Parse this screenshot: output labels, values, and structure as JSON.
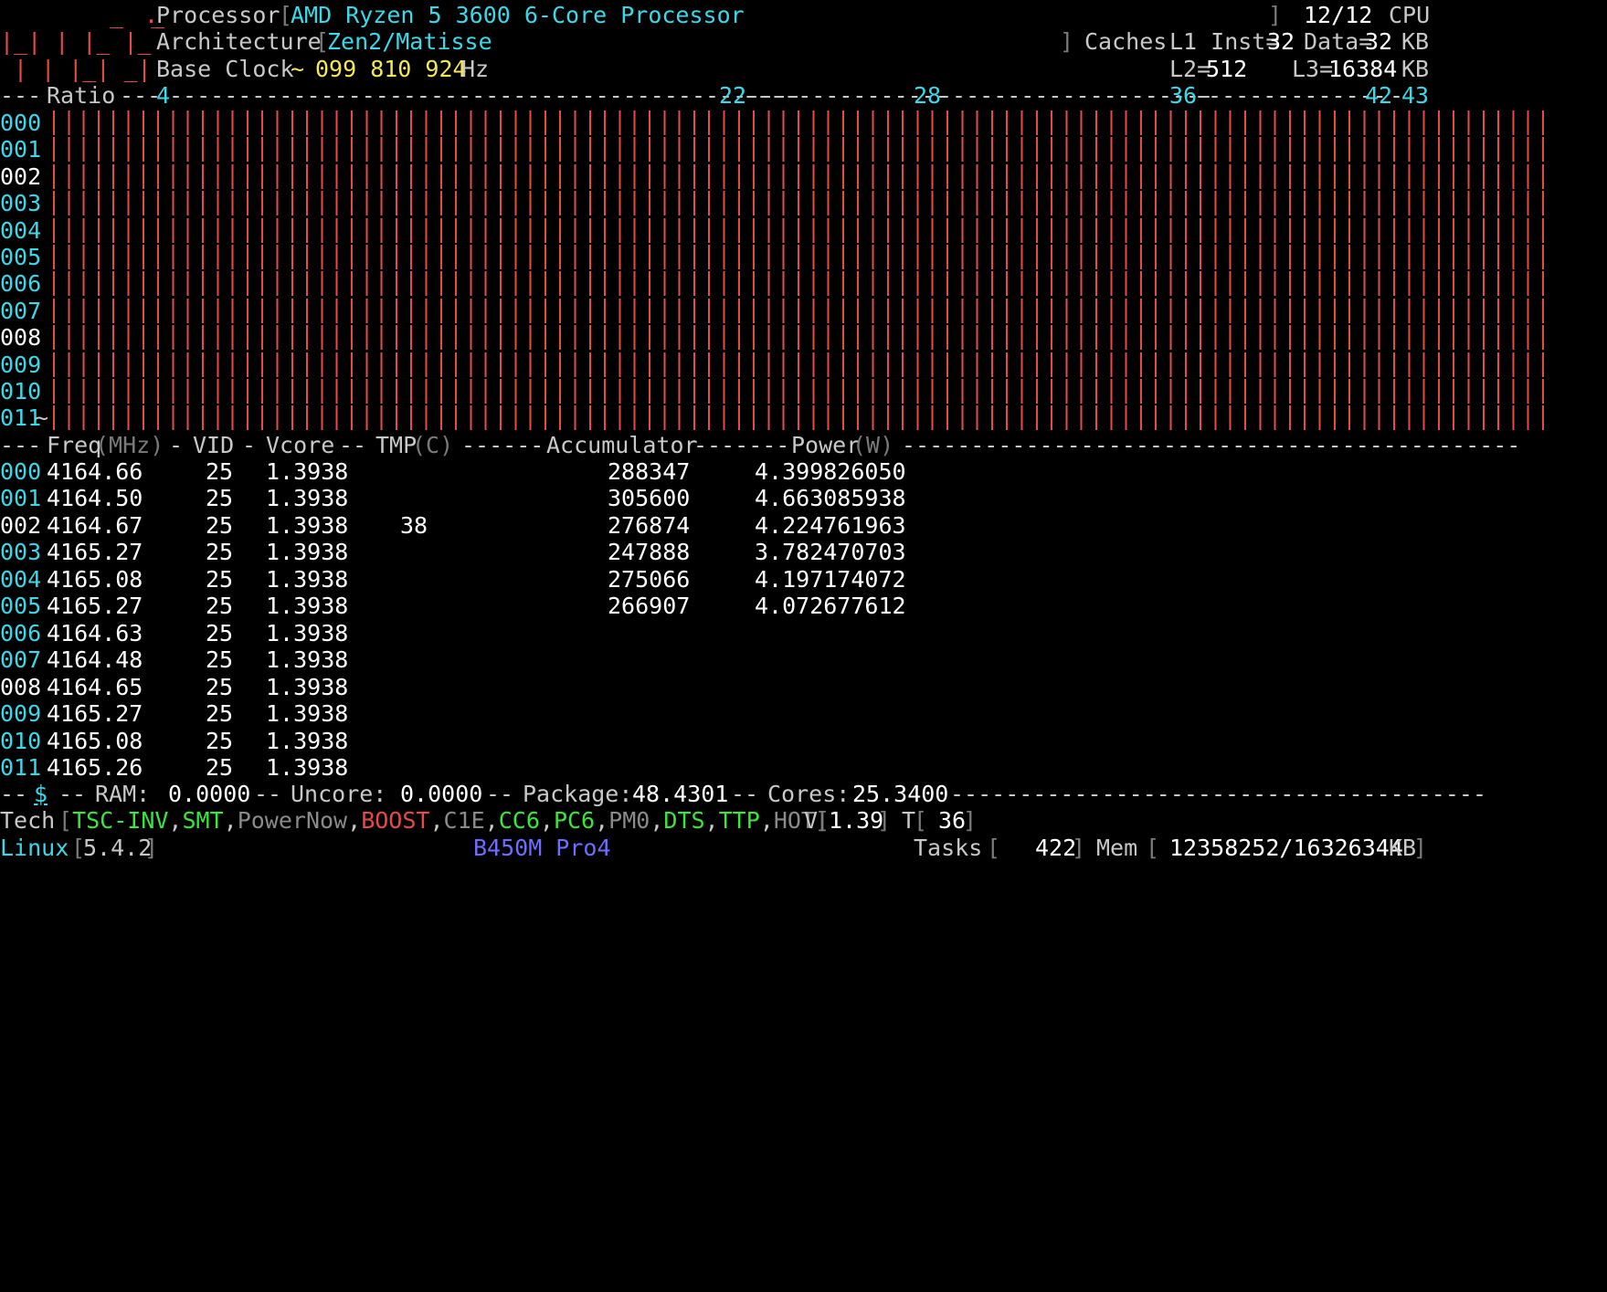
{
  "header": {
    "logo": {
      "line1": "  _  _  ",
      "line2": "|_| | |_ |_",
      "line3": " | | |_| _|",
      "dot": "."
    },
    "processor_label": "Processor",
    "processor_value": "AMD Ryzen 5 3600 6-Core Processor",
    "cpu_count": "12/12",
    "cpu_label": "CPU",
    "arch_label": "Architecture",
    "arch_value": "Zen2/Matisse",
    "caches_label": "Caches",
    "l1_label": "L1 Inst=",
    "l1_inst": "32",
    "l1_data_label": "Data=",
    "l1_data": "32",
    "kb": "KB",
    "base_clock_label": "Base Clock",
    "base_clock_tilde": "~",
    "base_clock_value": "099 810 924",
    "hz": "Hz",
    "l2_label": "L2=",
    "l2_value": "512",
    "l3_label": "L3=",
    "l3_value": "16384"
  },
  "ratio": {
    "label": "Ratio",
    "marks": [
      "4",
      "22",
      "28",
      "36",
      "42",
      "43"
    ]
  },
  "cores": [
    "000",
    "001",
    "002",
    "003",
    "004",
    "005",
    "006",
    "007",
    "008",
    "009",
    "010",
    "011"
  ],
  "bar_level": 1.0,
  "table": {
    "header": {
      "freq": "Freq",
      "freq_unit": "(MHz)",
      "vid": "VID",
      "vcore": "Vcore",
      "tmp": "TMP",
      "tmp_unit": "(C)",
      "accumulator": "Accumulator",
      "power": "Power",
      "power_unit": "(W)"
    },
    "rows": [
      {
        "core": "000",
        "freq": "4164.66",
        "vid": "25",
        "vcore": "1.3938",
        "tmp": "",
        "acc": "288347",
        "power": "4.399826050"
      },
      {
        "core": "001",
        "freq": "4164.50",
        "vid": "25",
        "vcore": "1.3938",
        "tmp": "",
        "acc": "305600",
        "power": "4.663085938"
      },
      {
        "core": "002",
        "freq": "4164.67",
        "vid": "25",
        "vcore": "1.3938",
        "tmp": "38",
        "acc": "276874",
        "power": "4.224761963"
      },
      {
        "core": "003",
        "freq": "4165.27",
        "vid": "25",
        "vcore": "1.3938",
        "tmp": "",
        "acc": "247888",
        "power": "3.782470703"
      },
      {
        "core": "004",
        "freq": "4165.08",
        "vid": "25",
        "vcore": "1.3938",
        "tmp": "",
        "acc": "275066",
        "power": "4.197174072"
      },
      {
        "core": "005",
        "freq": "4165.27",
        "vid": "25",
        "vcore": "1.3938",
        "tmp": "",
        "acc": "266907",
        "power": "4.072677612"
      },
      {
        "core": "006",
        "freq": "4164.63",
        "vid": "25",
        "vcore": "1.3938",
        "tmp": "",
        "acc": "",
        "power": ""
      },
      {
        "core": "007",
        "freq": "4164.48",
        "vid": "25",
        "vcore": "1.3938",
        "tmp": "",
        "acc": "",
        "power": ""
      },
      {
        "core": "008",
        "freq": "4164.65",
        "vid": "25",
        "vcore": "1.3938",
        "tmp": "",
        "acc": "",
        "power": ""
      },
      {
        "core": "009",
        "freq": "4165.27",
        "vid": "25",
        "vcore": "1.3938",
        "tmp": "",
        "acc": "",
        "power": ""
      },
      {
        "core": "010",
        "freq": "4165.08",
        "vid": "25",
        "vcore": "1.3938",
        "tmp": "",
        "acc": "",
        "power": ""
      },
      {
        "core": "011",
        "freq": "4165.26",
        "vid": "25",
        "vcore": "1.3938",
        "tmp": "",
        "acc": "",
        "power": ""
      }
    ]
  },
  "power_line": {
    "dollar": "$",
    "ram_label": "RAM:",
    "ram_value": "0.0000",
    "uncore_label": "Uncore:",
    "uncore_value": "0.0000",
    "package_label": "Package:",
    "package_value": "48.4301",
    "cores_label": "Cores:",
    "cores_value": "25.3400"
  },
  "tech": {
    "label": "Tech",
    "items": [
      {
        "name": "TSC-INV",
        "on": true
      },
      {
        "name": "SMT",
        "on": true
      },
      {
        "name": "PowerNow",
        "on": false
      },
      {
        "name": "BOOST",
        "on": true,
        "color": "red"
      },
      {
        "name": "C1E",
        "on": false
      },
      {
        "name": "CC6",
        "on": true
      },
      {
        "name": "PC6",
        "on": true
      },
      {
        "name": "PM0",
        "on": false
      },
      {
        "name": "DTS",
        "on": true
      },
      {
        "name": "TTP",
        "on": true
      },
      {
        "name": "HOT",
        "on": false
      }
    ],
    "v_label": "V",
    "v_value": "1.39",
    "t_label": "T",
    "t_value": "36"
  },
  "status": {
    "os": "Linux",
    "kernel": "5.4.2",
    "board": "B450M Pro4",
    "tasks_label": "Tasks",
    "tasks_value": "422",
    "mem_label": "Mem",
    "mem_value": "12358252/16326344",
    "mem_unit": "KB"
  },
  "colors": {
    "background": "#000000",
    "cyan": "#3ad8e8",
    "yellow": "#f5e65a",
    "red": "#e84a4a",
    "green": "#39e839",
    "blue": "#6d6dff"
  }
}
